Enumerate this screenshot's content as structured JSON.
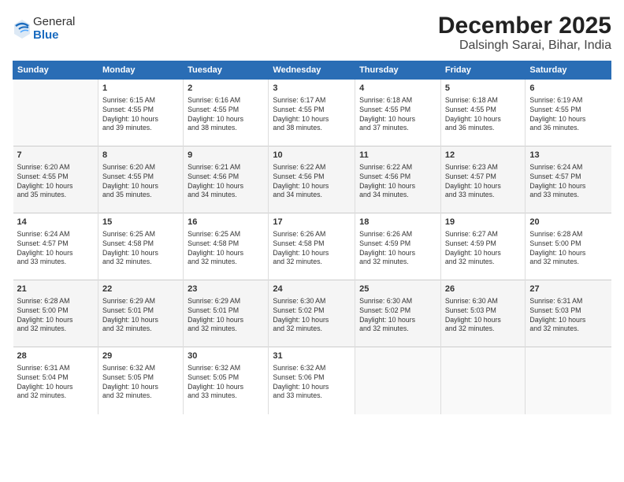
{
  "header": {
    "logo": {
      "general": "General",
      "blue": "Blue"
    },
    "title": "December 2025",
    "location": "Dalsingh Sarai, Bihar, India"
  },
  "calendar": {
    "days_of_week": [
      "Sunday",
      "Monday",
      "Tuesday",
      "Wednesday",
      "Thursday",
      "Friday",
      "Saturday"
    ],
    "weeks": [
      [
        {
          "num": "",
          "info": ""
        },
        {
          "num": "1",
          "info": "Sunrise: 6:15 AM\nSunset: 4:55 PM\nDaylight: 10 hours\nand 39 minutes."
        },
        {
          "num": "2",
          "info": "Sunrise: 6:16 AM\nSunset: 4:55 PM\nDaylight: 10 hours\nand 38 minutes."
        },
        {
          "num": "3",
          "info": "Sunrise: 6:17 AM\nSunset: 4:55 PM\nDaylight: 10 hours\nand 38 minutes."
        },
        {
          "num": "4",
          "info": "Sunrise: 6:18 AM\nSunset: 4:55 PM\nDaylight: 10 hours\nand 37 minutes."
        },
        {
          "num": "5",
          "info": "Sunrise: 6:18 AM\nSunset: 4:55 PM\nDaylight: 10 hours\nand 36 minutes."
        },
        {
          "num": "6",
          "info": "Sunrise: 6:19 AM\nSunset: 4:55 PM\nDaylight: 10 hours\nand 36 minutes."
        }
      ],
      [
        {
          "num": "7",
          "info": "Sunrise: 6:20 AM\nSunset: 4:55 PM\nDaylight: 10 hours\nand 35 minutes."
        },
        {
          "num": "8",
          "info": "Sunrise: 6:20 AM\nSunset: 4:55 PM\nDaylight: 10 hours\nand 35 minutes."
        },
        {
          "num": "9",
          "info": "Sunrise: 6:21 AM\nSunset: 4:56 PM\nDaylight: 10 hours\nand 34 minutes."
        },
        {
          "num": "10",
          "info": "Sunrise: 6:22 AM\nSunset: 4:56 PM\nDaylight: 10 hours\nand 34 minutes."
        },
        {
          "num": "11",
          "info": "Sunrise: 6:22 AM\nSunset: 4:56 PM\nDaylight: 10 hours\nand 34 minutes."
        },
        {
          "num": "12",
          "info": "Sunrise: 6:23 AM\nSunset: 4:57 PM\nDaylight: 10 hours\nand 33 minutes."
        },
        {
          "num": "13",
          "info": "Sunrise: 6:24 AM\nSunset: 4:57 PM\nDaylight: 10 hours\nand 33 minutes."
        }
      ],
      [
        {
          "num": "14",
          "info": "Sunrise: 6:24 AM\nSunset: 4:57 PM\nDaylight: 10 hours\nand 33 minutes."
        },
        {
          "num": "15",
          "info": "Sunrise: 6:25 AM\nSunset: 4:58 PM\nDaylight: 10 hours\nand 32 minutes."
        },
        {
          "num": "16",
          "info": "Sunrise: 6:25 AM\nSunset: 4:58 PM\nDaylight: 10 hours\nand 32 minutes."
        },
        {
          "num": "17",
          "info": "Sunrise: 6:26 AM\nSunset: 4:58 PM\nDaylight: 10 hours\nand 32 minutes."
        },
        {
          "num": "18",
          "info": "Sunrise: 6:26 AM\nSunset: 4:59 PM\nDaylight: 10 hours\nand 32 minutes."
        },
        {
          "num": "19",
          "info": "Sunrise: 6:27 AM\nSunset: 4:59 PM\nDaylight: 10 hours\nand 32 minutes."
        },
        {
          "num": "20",
          "info": "Sunrise: 6:28 AM\nSunset: 5:00 PM\nDaylight: 10 hours\nand 32 minutes."
        }
      ],
      [
        {
          "num": "21",
          "info": "Sunrise: 6:28 AM\nSunset: 5:00 PM\nDaylight: 10 hours\nand 32 minutes."
        },
        {
          "num": "22",
          "info": "Sunrise: 6:29 AM\nSunset: 5:01 PM\nDaylight: 10 hours\nand 32 minutes."
        },
        {
          "num": "23",
          "info": "Sunrise: 6:29 AM\nSunset: 5:01 PM\nDaylight: 10 hours\nand 32 minutes."
        },
        {
          "num": "24",
          "info": "Sunrise: 6:30 AM\nSunset: 5:02 PM\nDaylight: 10 hours\nand 32 minutes."
        },
        {
          "num": "25",
          "info": "Sunrise: 6:30 AM\nSunset: 5:02 PM\nDaylight: 10 hours\nand 32 minutes."
        },
        {
          "num": "26",
          "info": "Sunrise: 6:30 AM\nSunset: 5:03 PM\nDaylight: 10 hours\nand 32 minutes."
        },
        {
          "num": "27",
          "info": "Sunrise: 6:31 AM\nSunset: 5:03 PM\nDaylight: 10 hours\nand 32 minutes."
        }
      ],
      [
        {
          "num": "28",
          "info": "Sunrise: 6:31 AM\nSunset: 5:04 PM\nDaylight: 10 hours\nand 32 minutes."
        },
        {
          "num": "29",
          "info": "Sunrise: 6:32 AM\nSunset: 5:05 PM\nDaylight: 10 hours\nand 32 minutes."
        },
        {
          "num": "30",
          "info": "Sunrise: 6:32 AM\nSunset: 5:05 PM\nDaylight: 10 hours\nand 33 minutes."
        },
        {
          "num": "31",
          "info": "Sunrise: 6:32 AM\nSunset: 5:06 PM\nDaylight: 10 hours\nand 33 minutes."
        },
        {
          "num": "",
          "info": ""
        },
        {
          "num": "",
          "info": ""
        },
        {
          "num": "",
          "info": ""
        }
      ]
    ]
  }
}
